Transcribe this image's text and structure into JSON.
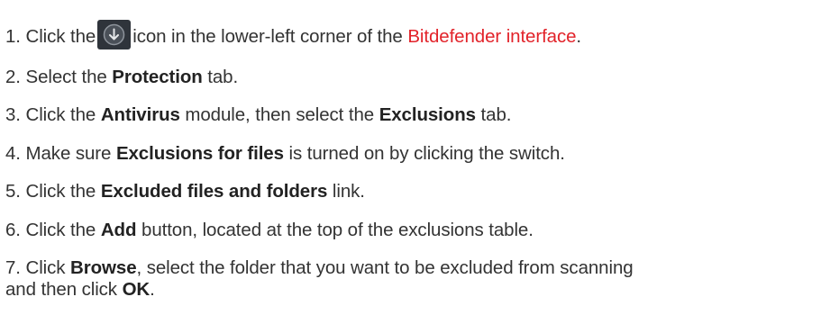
{
  "steps": [
    {
      "num": "1.",
      "pre": "Click the",
      "icon": "download-arrow-circle-icon",
      "mid": "icon in the lower-left corner of the",
      "link": "Bitdefender interface",
      "post": "."
    },
    {
      "num": "2.",
      "pre": "Select the",
      "bold1": "Protection",
      "post": "tab."
    },
    {
      "num": "3.",
      "pre": "Click the",
      "bold1": "Antivirus",
      "mid": "module, then select the",
      "bold2": "Exclusions",
      "post": "tab."
    },
    {
      "num": "4.",
      "pre": "Make sure",
      "bold1": "Exclusions for files",
      "post": "is turned on by clicking the switch."
    },
    {
      "num": "5.",
      "pre": "Click the",
      "bold1": "Excluded files and folders",
      "post": "link."
    },
    {
      "num": "6.",
      "pre": "Click the",
      "bold1": "Add",
      "post": "button, located at the top of the exclusions table."
    },
    {
      "num": "7.",
      "pre": "Click",
      "bold1": "Browse",
      "mid": ", select the folder that you want to be excluded from scanning",
      "line2": "and then click",
      "bold2": "OK",
      "post": "."
    }
  ],
  "colors": {
    "text": "#333333",
    "link": "#e2232a",
    "icon_bg": "#3a4048",
    "icon_ring": "#8e949c"
  }
}
